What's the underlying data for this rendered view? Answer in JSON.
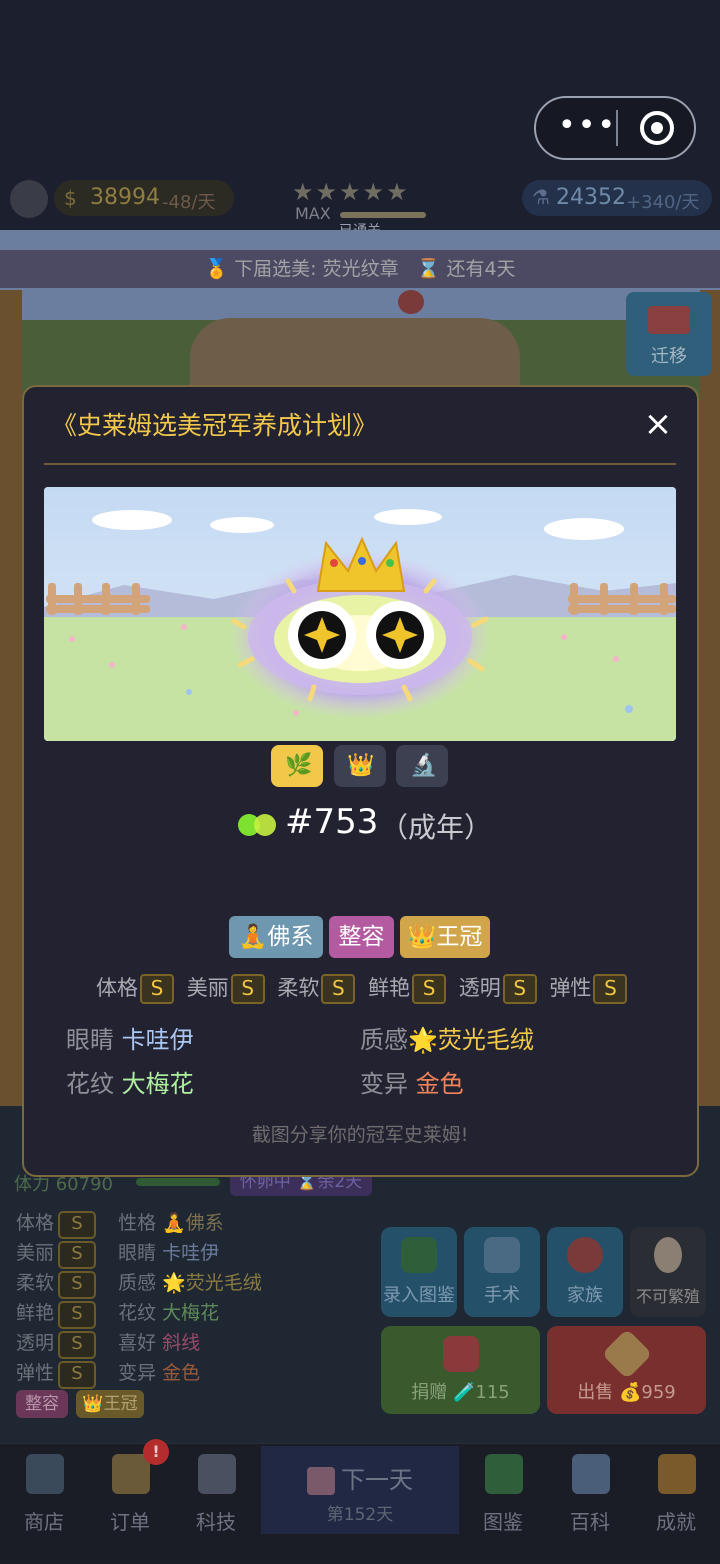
{
  "header": {
    "coins": "38994",
    "coins_rate": "-48/天",
    "stars": "★★★★★",
    "max_label": "MAX",
    "passed_label": "已通关",
    "gems": "24352",
    "gems_rate": "+340/天"
  },
  "banner": {
    "text": "下届选美: 荧光纹章",
    "countdown": "还有4天"
  },
  "move_button": "迁移",
  "modal": {
    "title": "《史莱姆选美冠军养成计划》",
    "close": "×",
    "slime_id": "#753",
    "age": "（成年）",
    "personality_tags": [
      {
        "icon": "🧘",
        "label": "佛系",
        "color": "#6e97b0"
      },
      {
        "label": "整容",
        "color": "#b45aa0"
      },
      {
        "icon": "👑",
        "label": "王冠",
        "color": "#d1a54a"
      }
    ],
    "stats": [
      {
        "label": "体格",
        "grade": "S"
      },
      {
        "label": "美丽",
        "grade": "S"
      },
      {
        "label": "柔软",
        "grade": "S"
      },
      {
        "label": "鲜艳",
        "grade": "S"
      },
      {
        "label": "透明",
        "grade": "S"
      },
      {
        "label": "弹性",
        "grade": "S"
      }
    ],
    "traits": {
      "eyes_label": "眼睛",
      "eyes_value": "卡哇伊",
      "texture_label": "质感",
      "texture_icon": "🌟",
      "texture_value": "荧光毛绒",
      "pattern_label": "花纹",
      "pattern_value": "大梅花",
      "mutation_label": "变异",
      "mutation_value": "金色"
    },
    "hint": "截图分享你的冠军史莱姆!"
  },
  "lower_panel": {
    "stamina": "体力 60790",
    "hatching": "怀卵中 ⌛余2天",
    "stats": [
      {
        "label": "体格",
        "grade": "S",
        "k2": "性格",
        "v2": "🧘佛系"
      },
      {
        "label": "美丽",
        "grade": "S",
        "k2": "眼睛",
        "v2": "卡哇伊"
      },
      {
        "label": "柔软",
        "grade": "S",
        "k2": "质感",
        "v2": "🌟荧光毛绒"
      },
      {
        "label": "鲜艳",
        "grade": "S",
        "k2": "花纹",
        "v2": "大梅花"
      },
      {
        "label": "透明",
        "grade": "S",
        "k2": "喜好",
        "v2": "斜线"
      },
      {
        "label": "弹性",
        "grade": "S",
        "k2": "变异",
        "v2": "金色"
      }
    ],
    "tags": [
      "整容",
      "👑王冠"
    ],
    "actions": {
      "record": "录入图鉴",
      "surgery": "手术",
      "family": "家族",
      "no_breed": "不可繁殖",
      "donate": "捐赠 🧪115",
      "sell": "出售 💰959"
    }
  },
  "nav": {
    "shop": "商店",
    "orders": "订单",
    "orders_badge": "!",
    "tech": "科技",
    "next_day": "下一天",
    "day_count": "第152天",
    "codex": "图鉴",
    "wiki": "百科",
    "achievements": "成就"
  }
}
